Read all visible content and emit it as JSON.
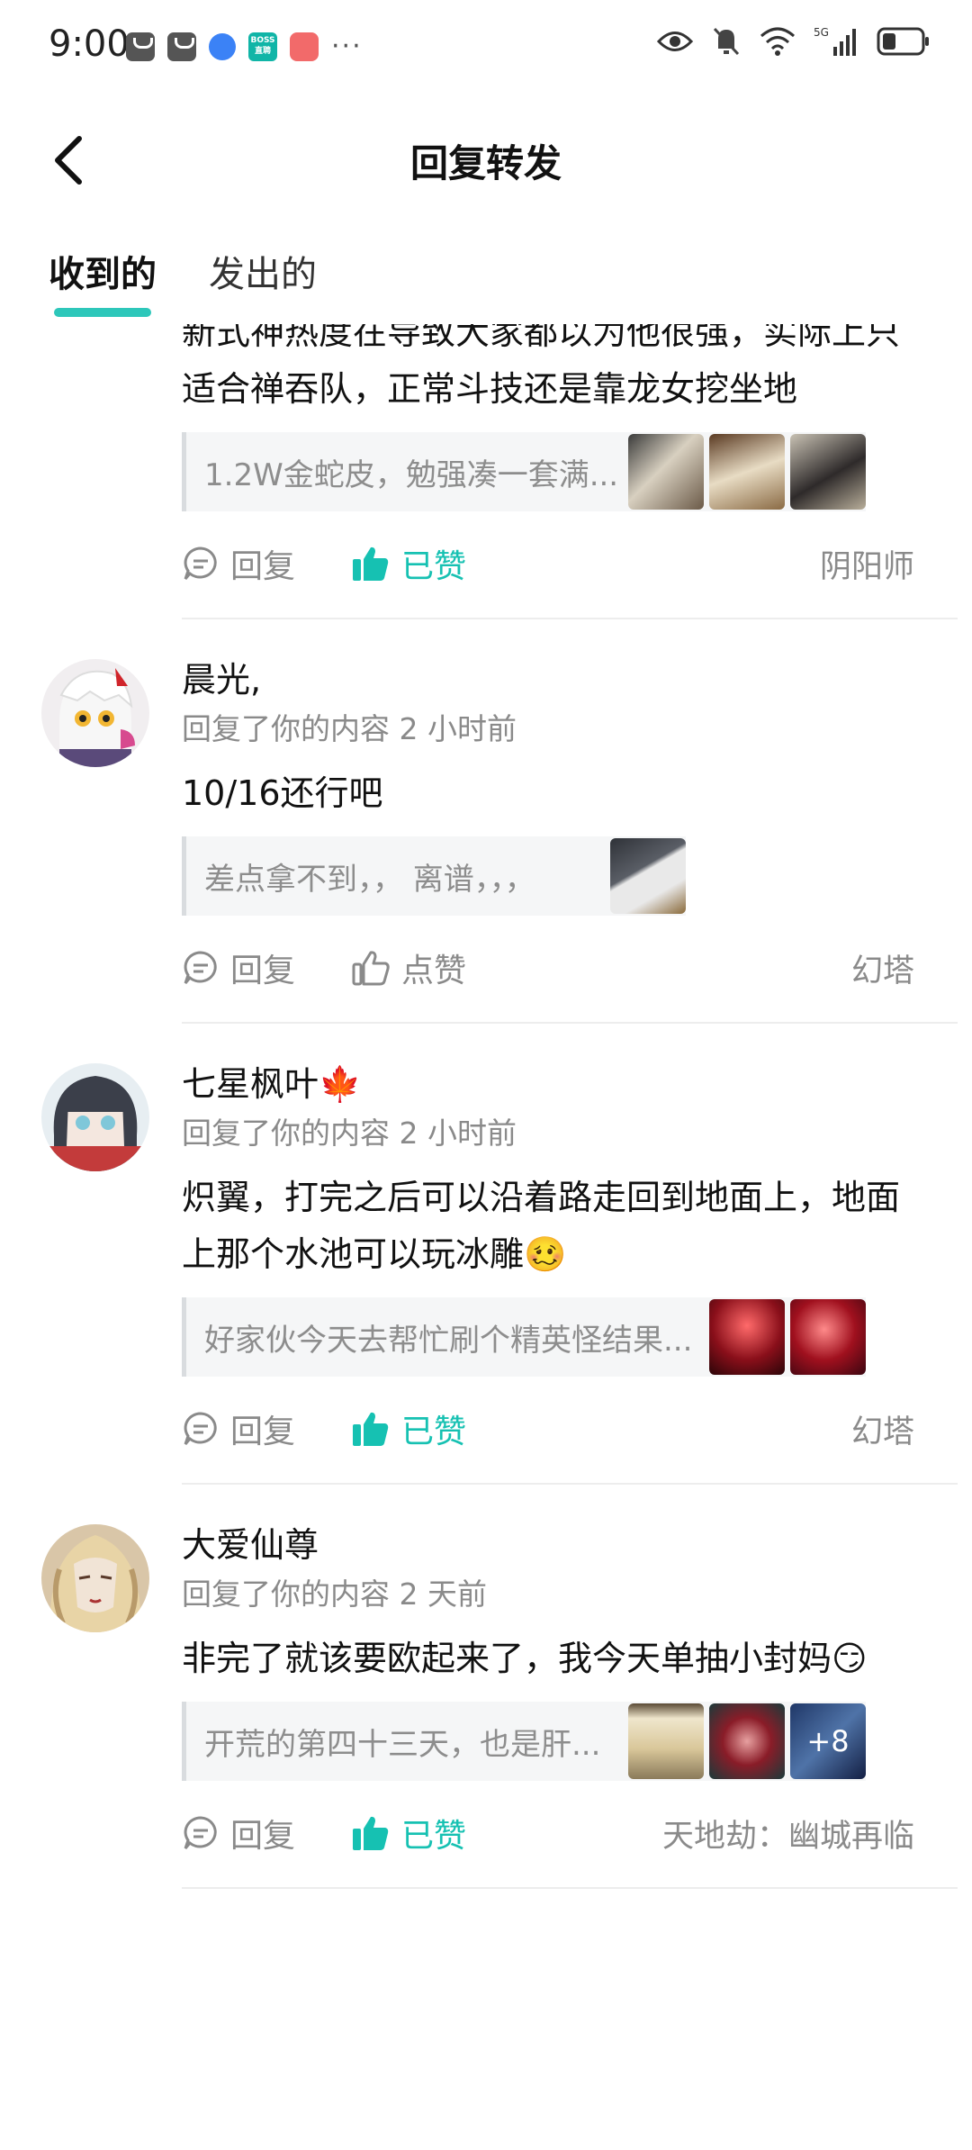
{
  "status_bar": {
    "time": "9:00",
    "boss_icon_text": "BOSS 直聘",
    "more": "···",
    "network": "5G"
  },
  "header": {
    "title": "回复转发"
  },
  "tabs": [
    {
      "label": "收到的",
      "active": true
    },
    {
      "label": "发出的",
      "active": false
    }
  ],
  "items": [
    {
      "partial": true,
      "comment": "新式神热度在导致大家都以为他很强，实际上只适合禅吞队，正常斗技还是靠龙女挖坐地",
      "quote": "1.2W金蛇皮，勉强凑一套满...",
      "thumbs": [
        {
          "icon": "game-screenshot"
        },
        {
          "icon": "game-screenshot"
        },
        {
          "icon": "game-screenshot"
        }
      ],
      "reply_label": "回复",
      "like_label": "已赞",
      "liked": true,
      "source": "阴阳师"
    },
    {
      "username": "晨光,",
      "meta": "回复了你的内容 2 小时前",
      "comment": "10/16还行吧",
      "quote": "差点拿不到，， 离谱，，，",
      "thumbs": [
        {
          "icon": "game-screenshot"
        }
      ],
      "reply_label": "回复",
      "like_label": "点赞",
      "liked": false,
      "source": "幻塔"
    },
    {
      "username": "七星枫叶🍁",
      "meta": "回复了你的内容 2 小时前",
      "comment": "炽翼，打完之后可以沿着路走回到地面上，地面上那个水池可以玩冰雕🥴",
      "quote": "好家伙今天去帮忙刷个精英怪结果...",
      "thumbs": [
        {
          "icon": "game-screenshot"
        },
        {
          "icon": "game-screenshot"
        }
      ],
      "reply_label": "回复",
      "like_label": "已赞",
      "liked": true,
      "source": "幻塔"
    },
    {
      "username": "大爱仙尊",
      "meta": "回复了你的内容 2 天前",
      "comment": "非完了就该要欧起来了，我今天单抽小封妈😏",
      "quote": "开荒的第四十三天，也是肝...",
      "thumbs": [
        {
          "icon": "game-screenshot"
        },
        {
          "icon": "game-screenshot"
        },
        {
          "icon": "game-screenshot",
          "more": "+8"
        }
      ],
      "reply_label": "回复",
      "like_label": "已赞",
      "liked": true,
      "source": "天地劫：幽城再临"
    }
  ],
  "colors": {
    "accent": "#16c1b2",
    "secondary_text": "#8a8a8a",
    "quote_bg": "#f5f6f7"
  }
}
